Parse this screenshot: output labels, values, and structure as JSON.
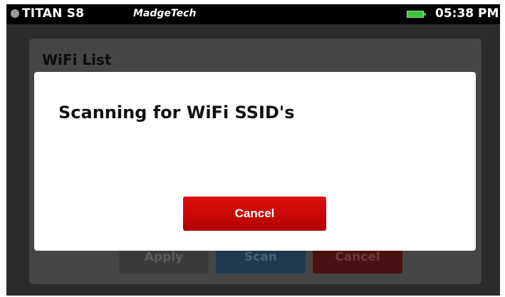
{
  "statusbar": {
    "device_name": "TITAN S8",
    "brand": "MadgeTech",
    "time": "05:38 PM",
    "battery_color": "#3ec33e"
  },
  "background_screen": {
    "title": "WiFi List",
    "apply_label": "Apply",
    "scan_label": "Scan",
    "cancel_label": "Cancel"
  },
  "dialog": {
    "message": "Scanning for WiFi SSID's",
    "cancel_label": "Cancel",
    "accent_color": "#d00000"
  }
}
